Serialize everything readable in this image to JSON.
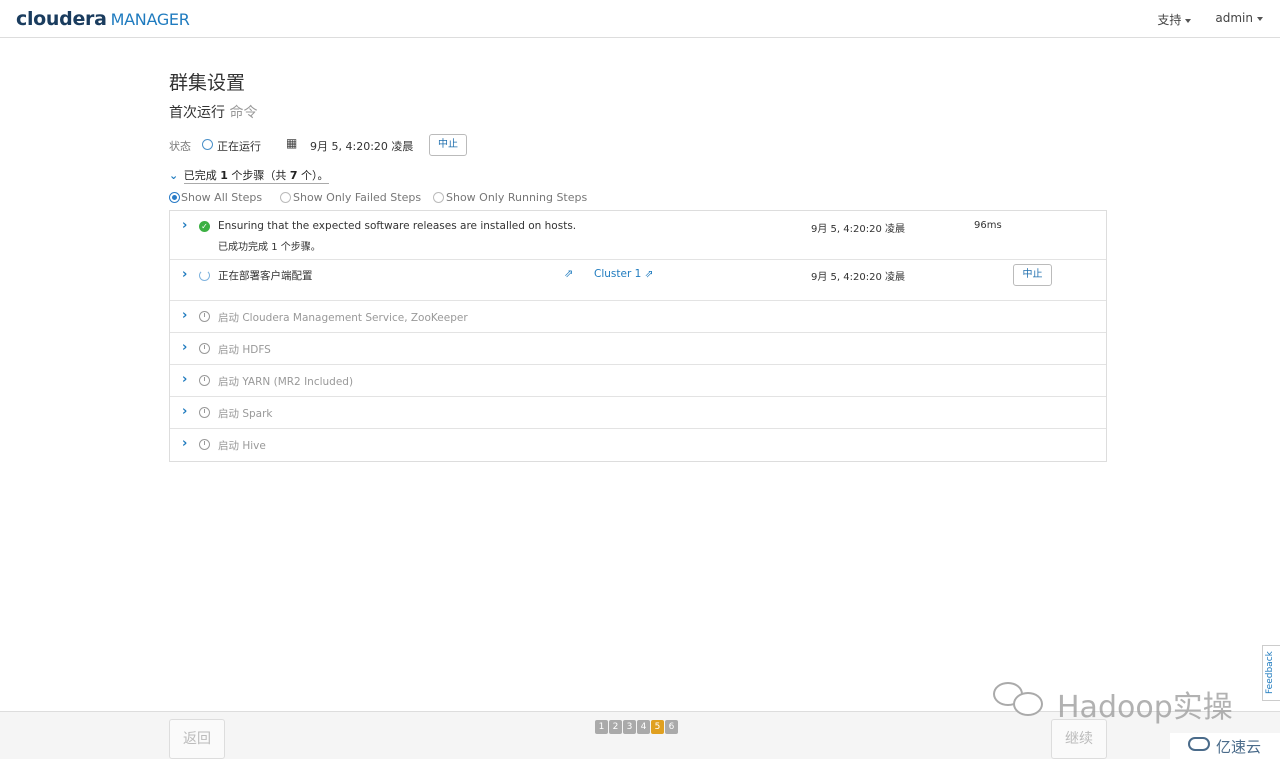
{
  "brand": {
    "logo_main": "cloudera",
    "logo_sub": "MANAGER"
  },
  "nav": {
    "support": "支持",
    "user": "admin"
  },
  "page": {
    "title": "群集设置",
    "subtitle_main": "首次运行",
    "subtitle_sub": "命令"
  },
  "status": {
    "label": "状态",
    "value": "正在运行",
    "timestamp": "9月 5, 4:20:20 凌晨",
    "abort_label": "中止"
  },
  "summary": {
    "prefix": "已完成",
    "done": "1",
    "middle": "个步骤（共",
    "total": "7",
    "suffix": "个）。"
  },
  "filters": {
    "all": "Show All Steps",
    "failed": "Show Only Failed Steps",
    "running": "Show Only Running Steps"
  },
  "steps": [
    {
      "name": "Ensuring that the expected software releases are installed on hosts.",
      "detail_prefix": "已成功完成",
      "detail_count": "1",
      "detail_suffix": "个步骤。",
      "time": "9月 5, 4:20:20 凌晨",
      "duration": "96ms"
    },
    {
      "name": "正在部署客户端配置",
      "link": "Cluster 1",
      "time": "9月 5, 4:20:20 凌晨",
      "abort_label": "中止"
    },
    {
      "name": "启动 Cloudera Management Service, ZooKeeper"
    },
    {
      "name": "启动 HDFS"
    },
    {
      "name": "启动 YARN (MR2 Included)"
    },
    {
      "name": "启动 Spark"
    },
    {
      "name": "启动 Hive"
    }
  ],
  "footer": {
    "back": "返回",
    "next": "继续",
    "pages": [
      "1",
      "2",
      "3",
      "4",
      "5",
      "6"
    ],
    "current_page": "5"
  },
  "feedback": "Feedback",
  "watermark": {
    "main": "Hadoop实操",
    "corner": "亿速云"
  },
  "colors": {
    "accent": "#1f7bbf",
    "success": "#3cb043",
    "current_page": "#e0a020"
  }
}
